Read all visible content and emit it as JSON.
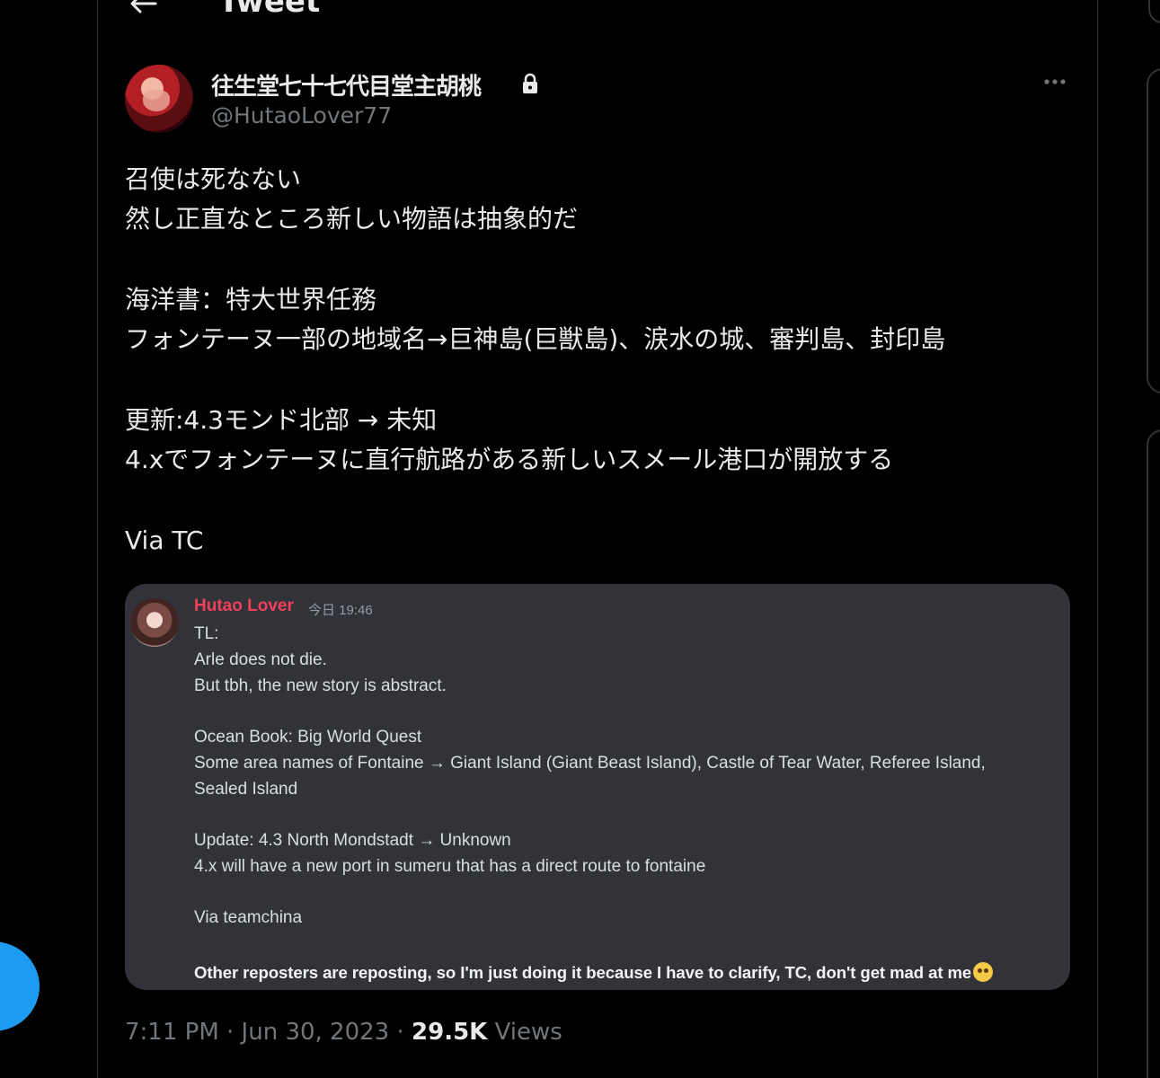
{
  "header": {
    "title": "Tweet"
  },
  "author": {
    "display_name": "往生堂七十七代目堂主胡桃",
    "handle": "@HutaoLover77"
  },
  "tweet": {
    "lines": [
      "召使は死なない",
      "然し正直なところ新しい物語は抽象的だ",
      "海洋書：特大世界任務",
      "フォンテーヌ一部の地域名→巨神島(巨獣島)、涙水の城、審判島、封印島",
      "更新:4.3モンド北部 → 未知",
      "4.xでフォンテーヌに直行航路がある新しいスメール港口が開放する",
      "Via TC"
    ]
  },
  "embed": {
    "author": "Hutao Lover",
    "timestamp": "今日 19:46",
    "lines": [
      "TL:",
      "Arle does not die.",
      "But tbh, the new story is abstract.",
      "Ocean Book: Big World Quest",
      "Some area names of Fontaine → Giant Island (Giant Beast Island), Castle of Tear Water, Referee Island,",
      "Sealed Island",
      "Update: 4.3 North Mondstadt → Unknown",
      "4.x will have a new port in sumeru that has a direct route to fontaine",
      "Via teamchina",
      "Other reposters are reposting, so I'm just doing it because I have to clarify, TC, don't get mad at me"
    ]
  },
  "meta": {
    "time_date": "7:11 PM · Jun 30, 2023 · ",
    "views_count": "29.5K",
    "views_label": " Views"
  },
  "colors": {
    "background": "#000000",
    "text": "#e7e9ea",
    "muted": "#71767b",
    "accent": "#1d9bf0",
    "embed_bg": "#313338",
    "embed_author": "#f23f5c"
  },
  "icons": [
    "back-arrow-icon",
    "lock-icon",
    "more-icon",
    "emoji-icon"
  ]
}
